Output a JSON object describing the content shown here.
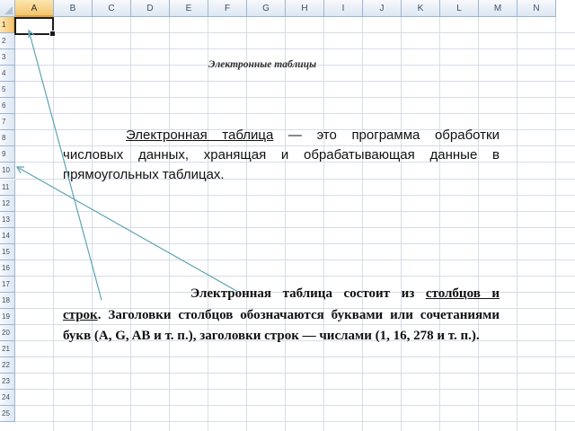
{
  "sheet": {
    "columns": [
      "A",
      "B",
      "C",
      "D",
      "E",
      "F",
      "G",
      "H",
      "I",
      "J",
      "K",
      "L",
      "M",
      "N"
    ],
    "rows": [
      "1",
      "2",
      "3",
      "4",
      "5",
      "6",
      "7",
      "8",
      "9",
      "10",
      "11",
      "12",
      "13",
      "14",
      "15",
      "16",
      "17",
      "18",
      "19",
      "20",
      "21",
      "22",
      "23",
      "24",
      "25"
    ],
    "active_column": "A",
    "active_row": "1",
    "header_color": "#dde6f2",
    "active_header_color": "#f4c46d",
    "gridline_color": "#d6dde7"
  },
  "content": {
    "title": "Электронные таблицы",
    "definition": {
      "term": "Электронная таблица",
      "text": " — это программа обработки числовых данных, хранящая и обрабатывающая данные в прямоугольных таблицах."
    },
    "structure": {
      "lead": "Электронная таблица состоит из",
      "term": "столбцов и строк",
      "text": ". Заголовки столбцов обозначаются буквами или сочетаниями букв (A, G, AB и т. п.), заголовки строк — числами (1, 16, 278 и т. п.)."
    },
    "arrow_color": "#5fa4b4"
  }
}
